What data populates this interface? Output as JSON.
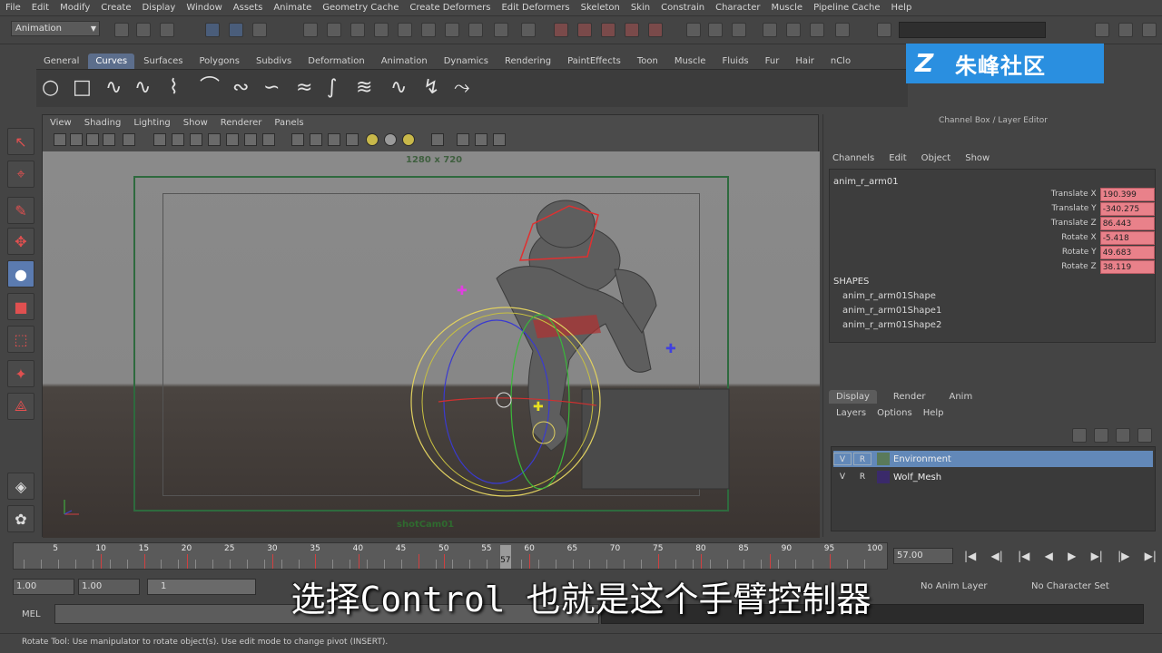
{
  "menubar": [
    "File",
    "Edit",
    "Modify",
    "Create",
    "Display",
    "Window",
    "Assets",
    "Animate",
    "Geometry Cache",
    "Create Deformers",
    "Edit Deformers",
    "Skeleton",
    "Skin",
    "Constrain",
    "Character",
    "Muscle",
    "Pipeline Cache",
    "Help"
  ],
  "mode_select": "Animation",
  "shelf_tabs": [
    "General",
    "Curves",
    "Surfaces",
    "Polygons",
    "Subdivs",
    "Deformation",
    "Animation",
    "Dynamics",
    "Rendering",
    "PaintEffects",
    "Toon",
    "Muscle",
    "Fluids",
    "Fur",
    "Hair",
    "nClo"
  ],
  "shelf_active": "Curves",
  "viewport": {
    "menu": [
      "View",
      "Shading",
      "Lighting",
      "Show",
      "Renderer",
      "Panels"
    ],
    "resolution": "1280 x 720",
    "camera": "shotCam01"
  },
  "channel_box": {
    "title": "Channel Box / Layer Editor",
    "menu": [
      "Channels",
      "Edit",
      "Object",
      "Show"
    ],
    "object": "anim_r_arm01",
    "attributes": [
      {
        "label": "Translate X",
        "value": "190.399"
      },
      {
        "label": "Translate Y",
        "value": "-340.275"
      },
      {
        "label": "Translate Z",
        "value": "86.443"
      },
      {
        "label": "Rotate X",
        "value": "-5.418"
      },
      {
        "label": "Rotate Y",
        "value": "49.683"
      },
      {
        "label": "Rotate Z",
        "value": "38.119"
      }
    ],
    "shapes_title": "SHAPES",
    "shapes": [
      "anim_r_arm01Shape",
      "anim_r_arm01Shape1",
      "anim_r_arm01Shape2"
    ]
  },
  "layers": {
    "tabs": [
      "Display",
      "Render",
      "Anim"
    ],
    "menu": [
      "Layers",
      "Options",
      "Help"
    ],
    "rows": [
      {
        "v": "V",
        "r": "R",
        "name": "Environment",
        "color": "#5a7a5a"
      },
      {
        "v": "V",
        "r": "R",
        "name": "Wolf_Mesh",
        "color": "#3a2a6a"
      }
    ]
  },
  "timeline": {
    "ticks": [
      "5",
      "10",
      "15",
      "20",
      "25",
      "30",
      "35",
      "40",
      "45",
      "50",
      "55",
      "60",
      "65",
      "70",
      "75",
      "80",
      "85",
      "90",
      "95",
      "100"
    ],
    "current": "57",
    "frame_field": "57.00"
  },
  "range": {
    "start": "1.00",
    "start2": "1.00",
    "bar_label": "1",
    "anim_layer": "No Anim Layer",
    "char_set": "No Character Set"
  },
  "command": {
    "label": "MEL"
  },
  "helpline": "Rotate Tool: Use manipulator to rotate object(s). Use edit mode to change pivot (INSERT).",
  "watermark": {
    "logo": "Z",
    "text": "朱峰社区"
  },
  "subtitle": "选择Control 也就是这个手臂控制器",
  "colors": {
    "accent": "#5c6e8c",
    "keyed": "#e9818a",
    "selected_layer": "#6288b8",
    "watermark_bg": "#2a8fe0"
  }
}
